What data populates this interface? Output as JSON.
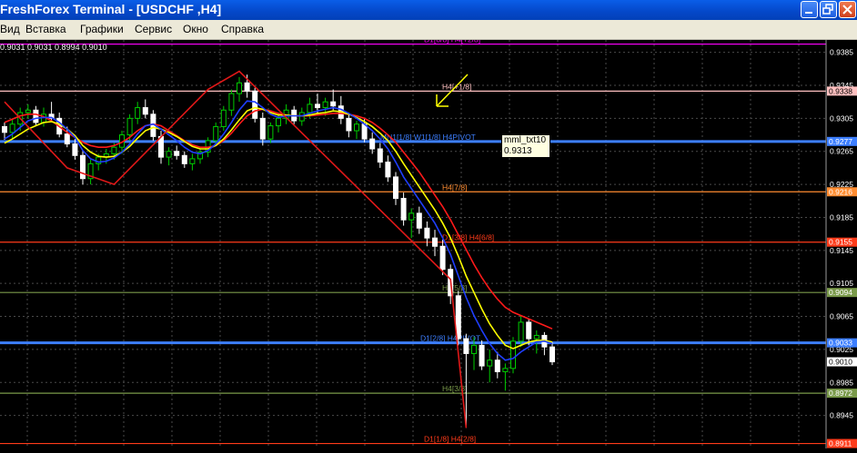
{
  "window": {
    "title": "FreshForex Terminal - [USDCHF ,H4]",
    "buttons": [
      "minimize",
      "restore",
      "close"
    ]
  },
  "menu": [
    "Вид",
    "Вставка",
    "Графики",
    "Сервис",
    "Окно",
    "Справка"
  ],
  "ohlc_text": "0.9031 0.9031 0.8994 0.9010",
  "tooltip": {
    "name": "mml_txt10",
    "value": "0.9313"
  },
  "colors": {
    "background": "#000000",
    "grid": "#4a4a4a",
    "bull": "#00cc00",
    "bear": "#ffffff",
    "fast_ma": "#1f3fff",
    "mid_ma": "#ffff00",
    "slow_ma": "#ff1a1a"
  },
  "chart_data": {
    "type": "candlestick",
    "symbol": "USDCHF",
    "timeframe": "H4",
    "y_ticks": [
      "0.9385",
      "0.9345",
      "0.9305",
      "0.9265",
      "0.9225",
      "0.9185",
      "0.9145",
      "0.9105",
      "0.9065",
      "0.9025",
      "0.8985",
      "0.8945"
    ],
    "ylim": [
      0.8905,
      0.94
    ],
    "current_price": "0.9010",
    "levels": [
      {
        "price": 0.9395,
        "label": "D1[6/8] H4[+2/8]",
        "axis_label": "",
        "color": "#ff00ff"
      },
      {
        "price": 0.9338,
        "label": "H4[+1/8]",
        "axis_label": "0.9338",
        "color": "#ffc0c0"
      },
      {
        "price": 0.9277,
        "label": "MN1[1/8] W1[1/8] H4PIVOT",
        "axis_label": "0.9277",
        "color": "#3d7fff"
      },
      {
        "price": 0.9216,
        "label": "H4[7/8]",
        "axis_label": "0.9216",
        "color": "#ff8c30"
      },
      {
        "price": 0.9155,
        "label": "D1[3/8] H4[6/8]",
        "axis_label": "0.9155",
        "color": "#ff3b1a"
      },
      {
        "price": 0.9094,
        "label": "H4[5/8]",
        "axis_label": "0.9094",
        "color": "#7a9a4a"
      },
      {
        "price": 0.9033,
        "label": "D1[2/8] H4PIVOT",
        "axis_label": "0.9033",
        "color": "#3d7fff"
      },
      {
        "price": 0.8972,
        "label": "H4[3/8]",
        "axis_label": "0.8972",
        "color": "#7a9a4a"
      },
      {
        "price": 0.8911,
        "label": "D1[1/8] H4[2/8]",
        "axis_label": "0.8911",
        "color": "#ff3b1a"
      }
    ],
    "candles": [
      [
        0.9295,
        0.93,
        0.9279,
        0.9288
      ],
      [
        0.9288,
        0.9305,
        0.928,
        0.9298
      ],
      [
        0.9298,
        0.9318,
        0.929,
        0.9312
      ],
      [
        0.9312,
        0.9322,
        0.9305,
        0.9315
      ],
      [
        0.9315,
        0.932,
        0.9296,
        0.93
      ],
      [
        0.93,
        0.9318,
        0.9295,
        0.931
      ],
      [
        0.931,
        0.9325,
        0.9302,
        0.9305
      ],
      [
        0.9305,
        0.9312,
        0.9282,
        0.9286
      ],
      [
        0.9286,
        0.9295,
        0.927,
        0.9274
      ],
      [
        0.9274,
        0.928,
        0.9255,
        0.926
      ],
      [
        0.926,
        0.9265,
        0.9225,
        0.9232
      ],
      [
        0.9232,
        0.9255,
        0.9225,
        0.925
      ],
      [
        0.925,
        0.9262,
        0.9242,
        0.9258
      ],
      [
        0.9258,
        0.9268,
        0.925,
        0.9262
      ],
      [
        0.9262,
        0.9275,
        0.9255,
        0.927
      ],
      [
        0.927,
        0.929,
        0.9262,
        0.9285
      ],
      [
        0.9285,
        0.931,
        0.9278,
        0.9305
      ],
      [
        0.9305,
        0.9325,
        0.9298,
        0.9318
      ],
      [
        0.9318,
        0.9328,
        0.9305,
        0.931
      ],
      [
        0.931,
        0.9315,
        0.9278,
        0.9283
      ],
      [
        0.9283,
        0.929,
        0.925,
        0.9258
      ],
      [
        0.9258,
        0.927,
        0.9248,
        0.9265
      ],
      [
        0.9265,
        0.9272,
        0.9255,
        0.926
      ],
      [
        0.926,
        0.9265,
        0.9245,
        0.925
      ],
      [
        0.925,
        0.9262,
        0.9242,
        0.9256
      ],
      [
        0.9256,
        0.9268,
        0.925,
        0.9264
      ],
      [
        0.9264,
        0.9282,
        0.9258,
        0.9278
      ],
      [
        0.9278,
        0.93,
        0.9272,
        0.9295
      ],
      [
        0.9295,
        0.932,
        0.929,
        0.9315
      ],
      [
        0.9315,
        0.934,
        0.9308,
        0.9335
      ],
      [
        0.9335,
        0.9355,
        0.9325,
        0.9348
      ],
      [
        0.9348,
        0.9358,
        0.933,
        0.9338
      ],
      [
        0.9338,
        0.9342,
        0.93,
        0.9305
      ],
      [
        0.9305,
        0.9312,
        0.9272,
        0.928
      ],
      [
        0.928,
        0.93,
        0.9275,
        0.9296
      ],
      [
        0.9296,
        0.9312,
        0.9288,
        0.9305
      ],
      [
        0.9305,
        0.9322,
        0.9298,
        0.9315
      ],
      [
        0.9315,
        0.932,
        0.9298,
        0.9302
      ],
      [
        0.9302,
        0.9318,
        0.9296,
        0.9312
      ],
      [
        0.9312,
        0.933,
        0.9305,
        0.9322
      ],
      [
        0.9322,
        0.9335,
        0.931,
        0.9318
      ],
      [
        0.9318,
        0.933,
        0.9308,
        0.9325
      ],
      [
        0.9325,
        0.934,
        0.9315,
        0.932
      ],
      [
        0.932,
        0.9332,
        0.9298,
        0.9305
      ],
      [
        0.9305,
        0.9312,
        0.9282,
        0.929
      ],
      [
        0.929,
        0.9302,
        0.928,
        0.9298
      ],
      [
        0.9298,
        0.9305,
        0.9276,
        0.928
      ],
      [
        0.928,
        0.9288,
        0.9262,
        0.9268
      ],
      [
        0.9268,
        0.9275,
        0.9245,
        0.9252
      ],
      [
        0.9252,
        0.926,
        0.9228,
        0.9234
      ],
      [
        0.9234,
        0.924,
        0.92,
        0.9208
      ],
      [
        0.9208,
        0.9215,
        0.9175,
        0.9182
      ],
      [
        0.9182,
        0.9196,
        0.916,
        0.919
      ],
      [
        0.919,
        0.9198,
        0.9165,
        0.9172
      ],
      [
        0.9172,
        0.918,
        0.915,
        0.916
      ],
      [
        0.916,
        0.917,
        0.9138,
        0.915
      ],
      [
        0.915,
        0.9158,
        0.9115,
        0.9122
      ],
      [
        0.9122,
        0.9128,
        0.908,
        0.909
      ],
      [
        0.909,
        0.9096,
        0.903,
        0.9038
      ],
      [
        0.9038,
        0.9044,
        0.893,
        0.902
      ],
      [
        0.902,
        0.904,
        0.9,
        0.903
      ],
      [
        0.903,
        0.9036,
        0.9,
        0.9005
      ],
      [
        0.9005,
        0.9025,
        0.8985,
        0.9012
      ],
      [
        0.9012,
        0.9022,
        0.899,
        0.8998
      ],
      [
        0.8998,
        0.9008,
        0.8975,
        0.9002
      ],
      [
        0.9002,
        0.904,
        0.8996,
        0.9035
      ],
      [
        0.9035,
        0.9066,
        0.9028,
        0.9058
      ],
      [
        0.9058,
        0.9062,
        0.903,
        0.9038
      ],
      [
        0.9038,
        0.9048,
        0.902,
        0.9042
      ],
      [
        0.9042,
        0.9046,
        0.9018,
        0.9028
      ],
      [
        0.9028,
        0.9034,
        0.9006,
        0.901
      ]
    ],
    "fast_ma": [
      0.928,
      0.9286,
      0.9294,
      0.9302,
      0.9305,
      0.9306,
      0.9306,
      0.93,
      0.9292,
      0.9282,
      0.9266,
      0.9256,
      0.9252,
      0.9253,
      0.9257,
      0.9264,
      0.9274,
      0.9286,
      0.9296,
      0.9298,
      0.9292,
      0.9285,
      0.9278,
      0.927,
      0.9264,
      0.9262,
      0.9266,
      0.9274,
      0.9286,
      0.93,
      0.9315,
      0.9326,
      0.9325,
      0.9318,
      0.931,
      0.9306,
      0.9308,
      0.9308,
      0.9308,
      0.9311,
      0.9314,
      0.9316,
      0.9318,
      0.9316,
      0.9311,
      0.9305,
      0.9298,
      0.929,
      0.928,
      0.9268,
      0.9252,
      0.9234,
      0.922,
      0.9206,
      0.9192,
      0.9178,
      0.916,
      0.914,
      0.9114,
      0.9088,
      0.9066,
      0.9048,
      0.9032,
      0.902,
      0.9012,
      0.9014,
      0.9022,
      0.9028,
      0.9034,
      0.9035,
      0.9032
    ],
    "mid_ma": [
      0.9275,
      0.928,
      0.9286,
      0.9292,
      0.9296,
      0.93,
      0.9301,
      0.9298,
      0.9292,
      0.9284,
      0.9272,
      0.9264,
      0.9259,
      0.9258,
      0.9259,
      0.9264,
      0.9271,
      0.9281,
      0.929,
      0.9294,
      0.9292,
      0.9288,
      0.9283,
      0.9277,
      0.9271,
      0.9268,
      0.9268,
      0.9272,
      0.928,
      0.9291,
      0.9303,
      0.9314,
      0.9318,
      0.9316,
      0.9312,
      0.9309,
      0.9309,
      0.9308,
      0.9308,
      0.9309,
      0.9311,
      0.9312,
      0.9314,
      0.9313,
      0.931,
      0.9306,
      0.9301,
      0.9295,
      0.9287,
      0.9278,
      0.9265,
      0.925,
      0.9236,
      0.9222,
      0.9208,
      0.9194,
      0.9178,
      0.916,
      0.9138,
      0.9114,
      0.9094,
      0.9074,
      0.9056,
      0.9042,
      0.903,
      0.9026,
      0.903,
      0.9034,
      0.9036,
      0.9036,
      0.9034
    ],
    "slow_ma": [
      0.93,
      0.9304,
      0.9308,
      0.931,
      0.931,
      0.9307,
      0.9302,
      0.9295,
      0.9288,
      0.9282,
      0.9276,
      0.9272,
      0.927,
      0.927,
      0.9272,
      0.9276,
      0.9282,
      0.929,
      0.9296,
      0.9298,
      0.9296,
      0.929,
      0.9284,
      0.9278,
      0.9273,
      0.927,
      0.927,
      0.9272,
      0.9278,
      0.9287,
      0.9298,
      0.9308,
      0.9314,
      0.9316,
      0.9314,
      0.9311,
      0.9309,
      0.9308,
      0.9308,
      0.9308,
      0.9309,
      0.931,
      0.9311,
      0.9311,
      0.931,
      0.9308,
      0.9305,
      0.93,
      0.9293,
      0.9285,
      0.9276,
      0.9264,
      0.9252,
      0.924,
      0.9226,
      0.9212,
      0.9198,
      0.9182,
      0.9164,
      0.9146,
      0.9128,
      0.9112,
      0.9098,
      0.9086,
      0.9076,
      0.907,
      0.9066,
      0.9062,
      0.9058,
      0.9054,
      0.905
    ],
    "zigzag": [
      [
        0,
        0.9325
      ],
      [
        8,
        0.9245
      ],
      [
        14,
        0.9225
      ],
      [
        26,
        0.934
      ],
      [
        30,
        0.9362
      ],
      [
        57,
        0.911
      ],
      [
        59,
        0.893
      ]
    ]
  }
}
